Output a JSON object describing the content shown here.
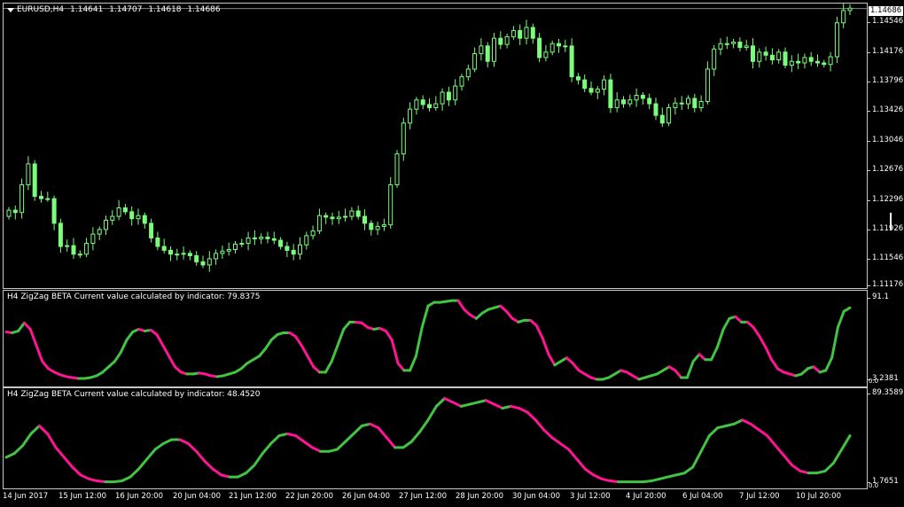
{
  "window": {
    "symbol_label": "EURUSD,H4",
    "ohlc": [
      "1.14641",
      "1.14707",
      "1.14618",
      "1.14686"
    ],
    "current_price_tag": "1.14686"
  },
  "colors": {
    "background": "#000000",
    "bull_candle": "#7CFC7C",
    "up": "#42c442",
    "down": "#ff1493",
    "axis": "#c8c8c8"
  },
  "price_axis": [
    "1.14686",
    "1.14546",
    "1.14176",
    "1.13796",
    "1.13426",
    "1.13046",
    "1.12676",
    "1.12296",
    "1.11926",
    "1.11546",
    "1.11176"
  ],
  "indicator1": {
    "title": "H4 ZigZag BETA Current value calculated by indicator: 79.8375",
    "axis_top": "91.1",
    "axis_bottom": "0.0",
    "axis_bottom_alt": "3.2381"
  },
  "indicator2": {
    "title": "H4 ZigZag BETA Current value calculated by indicator: 48.4520",
    "axis_top": "89.3589",
    "axis_bottom": "1.7651",
    "axis_bottom_alt": "0.0"
  },
  "time_axis": [
    "14 Jun 2017",
    "15 Jun 12:00",
    "16 Jun 20:00",
    "20 Jun 04:00",
    "21 Jun 12:00",
    "22 Jun 20:00",
    "26 Jun 04:00",
    "27 Jun 12:00",
    "28 Jun 20:00",
    "30 Jun 04:00",
    "3 Jul 12:00",
    "4 Jul 20:00",
    "6 Jul 04:00",
    "7 Jul 12:00",
    "10 Jul 20:00"
  ],
  "chart_data": [
    {
      "type": "candlestick",
      "title": "EURUSD,H4",
      "ylim": [
        1.1106,
        1.1475
      ],
      "closes": [
        1.1207,
        1.1204,
        1.124,
        1.1267,
        1.1225,
        1.1222,
        1.1222,
        1.119,
        1.116,
        1.1161,
        1.115,
        1.115,
        1.1164,
        1.1176,
        1.1182,
        1.1194,
        1.1199,
        1.121,
        1.1205,
        1.1196,
        1.12,
        1.119,
        1.1171,
        1.116,
        1.1155,
        1.115,
        1.115,
        1.1151,
        1.1148,
        1.114,
        1.1136,
        1.1144,
        1.1151,
        1.1154,
        1.1156,
        1.1163,
        1.1164,
        1.1171,
        1.117,
        1.1172,
        1.117,
        1.1168,
        1.116,
        1.1155,
        1.115,
        1.1162,
        1.1174,
        1.118,
        1.12,
        1.1198,
        1.1196,
        1.1198,
        1.1199,
        1.1206,
        1.1199,
        1.119,
        1.1182,
        1.1186,
        1.1188,
        1.124,
        1.128,
        1.132,
        1.1338,
        1.135,
        1.1344,
        1.134,
        1.1345,
        1.136,
        1.135,
        1.1368,
        1.138,
        1.139,
        1.141,
        1.142,
        1.14,
        1.143,
        1.1422,
        1.1432,
        1.144,
        1.143,
        1.1444,
        1.143,
        1.1405,
        1.1412,
        1.1423,
        1.142,
        1.142,
        1.138,
        1.1376,
        1.1365,
        1.136,
        1.1364,
        1.1376,
        1.134,
        1.135,
        1.1345,
        1.135,
        1.1356,
        1.1352,
        1.1345,
        1.133,
        1.132,
        1.134,
        1.1346,
        1.1345,
        1.1352,
        1.134,
        1.1348,
        1.139,
        1.1416,
        1.1423,
        1.1423,
        1.1425,
        1.1418,
        1.142,
        1.14,
        1.1412,
        1.1408,
        1.1402,
        1.1412,
        1.1395,
        1.14,
        1.1398,
        1.1405,
        1.14,
        1.1398,
        1.1396,
        1.1406,
        1.145,
        1.1466,
        1.1469
      ]
    },
    {
      "type": "line",
      "title": "H4 ZigZag BETA Current value calculated by indicator: 79.8375",
      "ylim": [
        0,
        91.1
      ],
      "values": [
        55,
        54,
        56,
        65,
        58,
        40,
        22,
        14,
        10,
        7,
        5,
        4,
        3,
        3,
        4,
        6,
        10,
        16,
        22,
        32,
        46,
        55,
        58,
        56,
        57,
        52,
        40,
        28,
        16,
        10,
        8,
        8,
        9,
        8,
        6,
        5,
        6,
        8,
        10,
        14,
        20,
        24,
        28,
        36,
        46,
        52,
        54,
        54,
        50,
        40,
        28,
        16,
        10,
        10,
        22,
        40,
        58,
        66,
        66,
        65,
        60,
        58,
        59,
        56,
        46,
        20,
        12,
        12,
        28,
        60,
        84,
        88,
        88,
        89,
        90,
        90,
        80,
        74,
        70,
        76,
        80,
        82,
        84,
        78,
        70,
        66,
        68,
        68,
        62,
        48,
        30,
        18,
        22,
        26,
        20,
        12,
        8,
        4,
        2,
        2,
        4,
        8,
        12,
        10,
        6,
        2,
        4,
        6,
        8,
        12,
        16,
        12,
        4,
        4,
        22,
        30,
        24,
        24,
        38,
        58,
        70,
        72,
        66,
        66,
        60,
        50,
        38,
        24,
        14,
        10,
        8,
        6,
        8,
        14,
        16,
        10,
        12,
        26,
        60,
        78,
        82
      ]
    },
    {
      "type": "line",
      "title": "H4 ZigZag BETA Current value calculated by indicator: 48.4520",
      "ylim": [
        1.7651,
        89.3589
      ],
      "values": [
        28,
        32,
        40,
        52,
        60,
        52,
        38,
        28,
        18,
        10,
        6,
        4,
        3,
        3,
        4,
        8,
        16,
        26,
        36,
        42,
        46,
        46,
        42,
        34,
        24,
        16,
        10,
        8,
        8,
        12,
        20,
        32,
        42,
        50,
        52,
        50,
        44,
        38,
        34,
        34,
        36,
        44,
        52,
        60,
        62,
        58,
        48,
        38,
        38,
        44,
        54,
        66,
        80,
        88,
        84,
        80,
        82,
        84,
        86,
        82,
        78,
        80,
        78,
        74,
        66,
        56,
        48,
        42,
        36,
        26,
        16,
        10,
        6,
        4,
        3,
        3,
        3,
        3,
        4,
        6,
        8,
        10,
        12,
        18,
        34,
        50,
        58,
        60,
        62,
        66,
        62,
        56,
        50,
        40,
        30,
        20,
        14,
        12,
        12,
        14,
        22,
        36,
        50
      ]
    }
  ]
}
